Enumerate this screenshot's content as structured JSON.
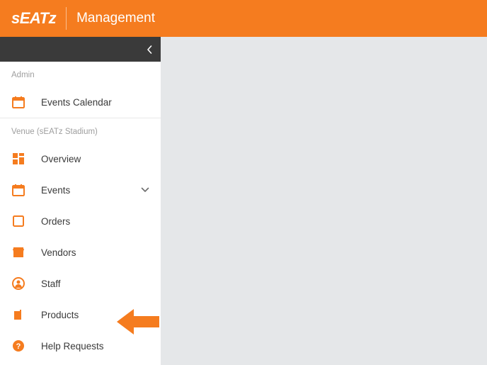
{
  "header": {
    "logo_text": "sEATz",
    "title": "Management"
  },
  "sidebar": {
    "sections": [
      {
        "label": "Admin",
        "items": [
          {
            "label": "Events Calendar",
            "icon": "calendar-icon",
            "expandable": false
          }
        ]
      },
      {
        "label": "Venue (sEATz Stadium)",
        "items": [
          {
            "label": "Overview",
            "icon": "dashboard-icon",
            "expandable": false
          },
          {
            "label": "Events",
            "icon": "calendar-icon",
            "expandable": true
          },
          {
            "label": "Orders",
            "icon": "orders-icon",
            "expandable": false
          },
          {
            "label": "Vendors",
            "icon": "store-icon",
            "expandable": false
          },
          {
            "label": "Staff",
            "icon": "staff-icon",
            "expandable": false
          },
          {
            "label": "Products",
            "icon": "products-icon",
            "expandable": false
          },
          {
            "label": "Help Requests",
            "icon": "help-icon",
            "expandable": false
          }
        ]
      }
    ]
  },
  "colors": {
    "brand": "#f57c1f",
    "dark": "#3a3a3a"
  }
}
